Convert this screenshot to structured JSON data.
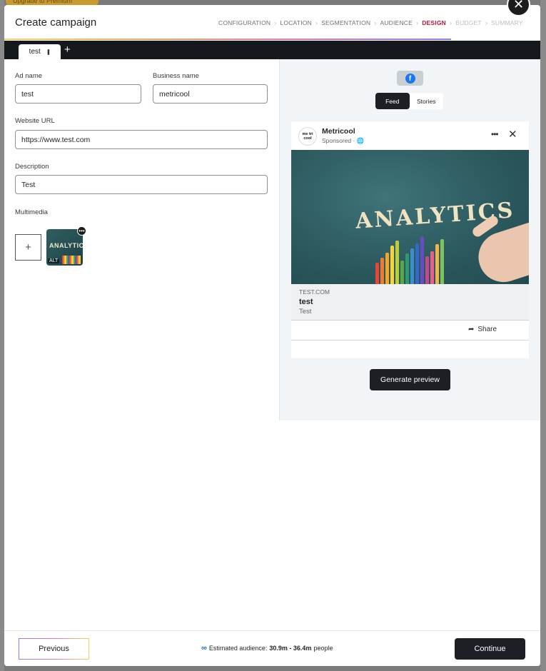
{
  "background": {
    "banner_text": "Upgrade to Premium"
  },
  "modal": {
    "title": "Create campaign",
    "close_glyph": "✕",
    "steps": [
      {
        "label": "CONFIGURATION",
        "state": "done"
      },
      {
        "label": "LOCATION",
        "state": "done"
      },
      {
        "label": "SEGMENTATION",
        "state": "done"
      },
      {
        "label": "AUDIENCE",
        "state": "done"
      },
      {
        "label": "DESIGN",
        "state": "active"
      },
      {
        "label": "BUDGET",
        "state": "future"
      },
      {
        "label": "SUMMARY",
        "state": "future"
      }
    ],
    "step_separator": "›",
    "accent_color": "#c0143c"
  },
  "tabs": {
    "items": [
      {
        "label": "test"
      }
    ],
    "add_glyph": "+"
  },
  "form": {
    "ad_name": {
      "label": "Ad name",
      "value": "test"
    },
    "business_name": {
      "label": "Business name",
      "value": "metricool"
    },
    "website_url": {
      "label": "Website URL",
      "value": "https://www.test.com"
    },
    "description": {
      "label": "Description",
      "value": "Test"
    },
    "multimedia": {
      "label": "Multimedia",
      "add_glyph": "+",
      "thumb_text": "ANALYTICS",
      "thumb_alt_badge": "ALT",
      "menu_glyph": "•••"
    }
  },
  "preview": {
    "network_icon": "facebook-icon",
    "placements": [
      {
        "label": "Feed",
        "active": true
      },
      {
        "label": "Stories",
        "active": false
      }
    ],
    "card": {
      "avatar_text": "me tri cool",
      "page_name": "Metricool",
      "sponsored": "Sponsored · 🌐",
      "image_word": "ANALYTICS",
      "domain": "TEST.COM",
      "title": "test",
      "description": "Test",
      "share_label": "Share"
    },
    "generate_label": "Generate preview"
  },
  "footer": {
    "previous_label": "Previous",
    "audience_prefix": "Estimated audience:",
    "audience_range": "30.9m - 36.4m",
    "audience_suffix": "people",
    "continue_label": "Continue"
  }
}
